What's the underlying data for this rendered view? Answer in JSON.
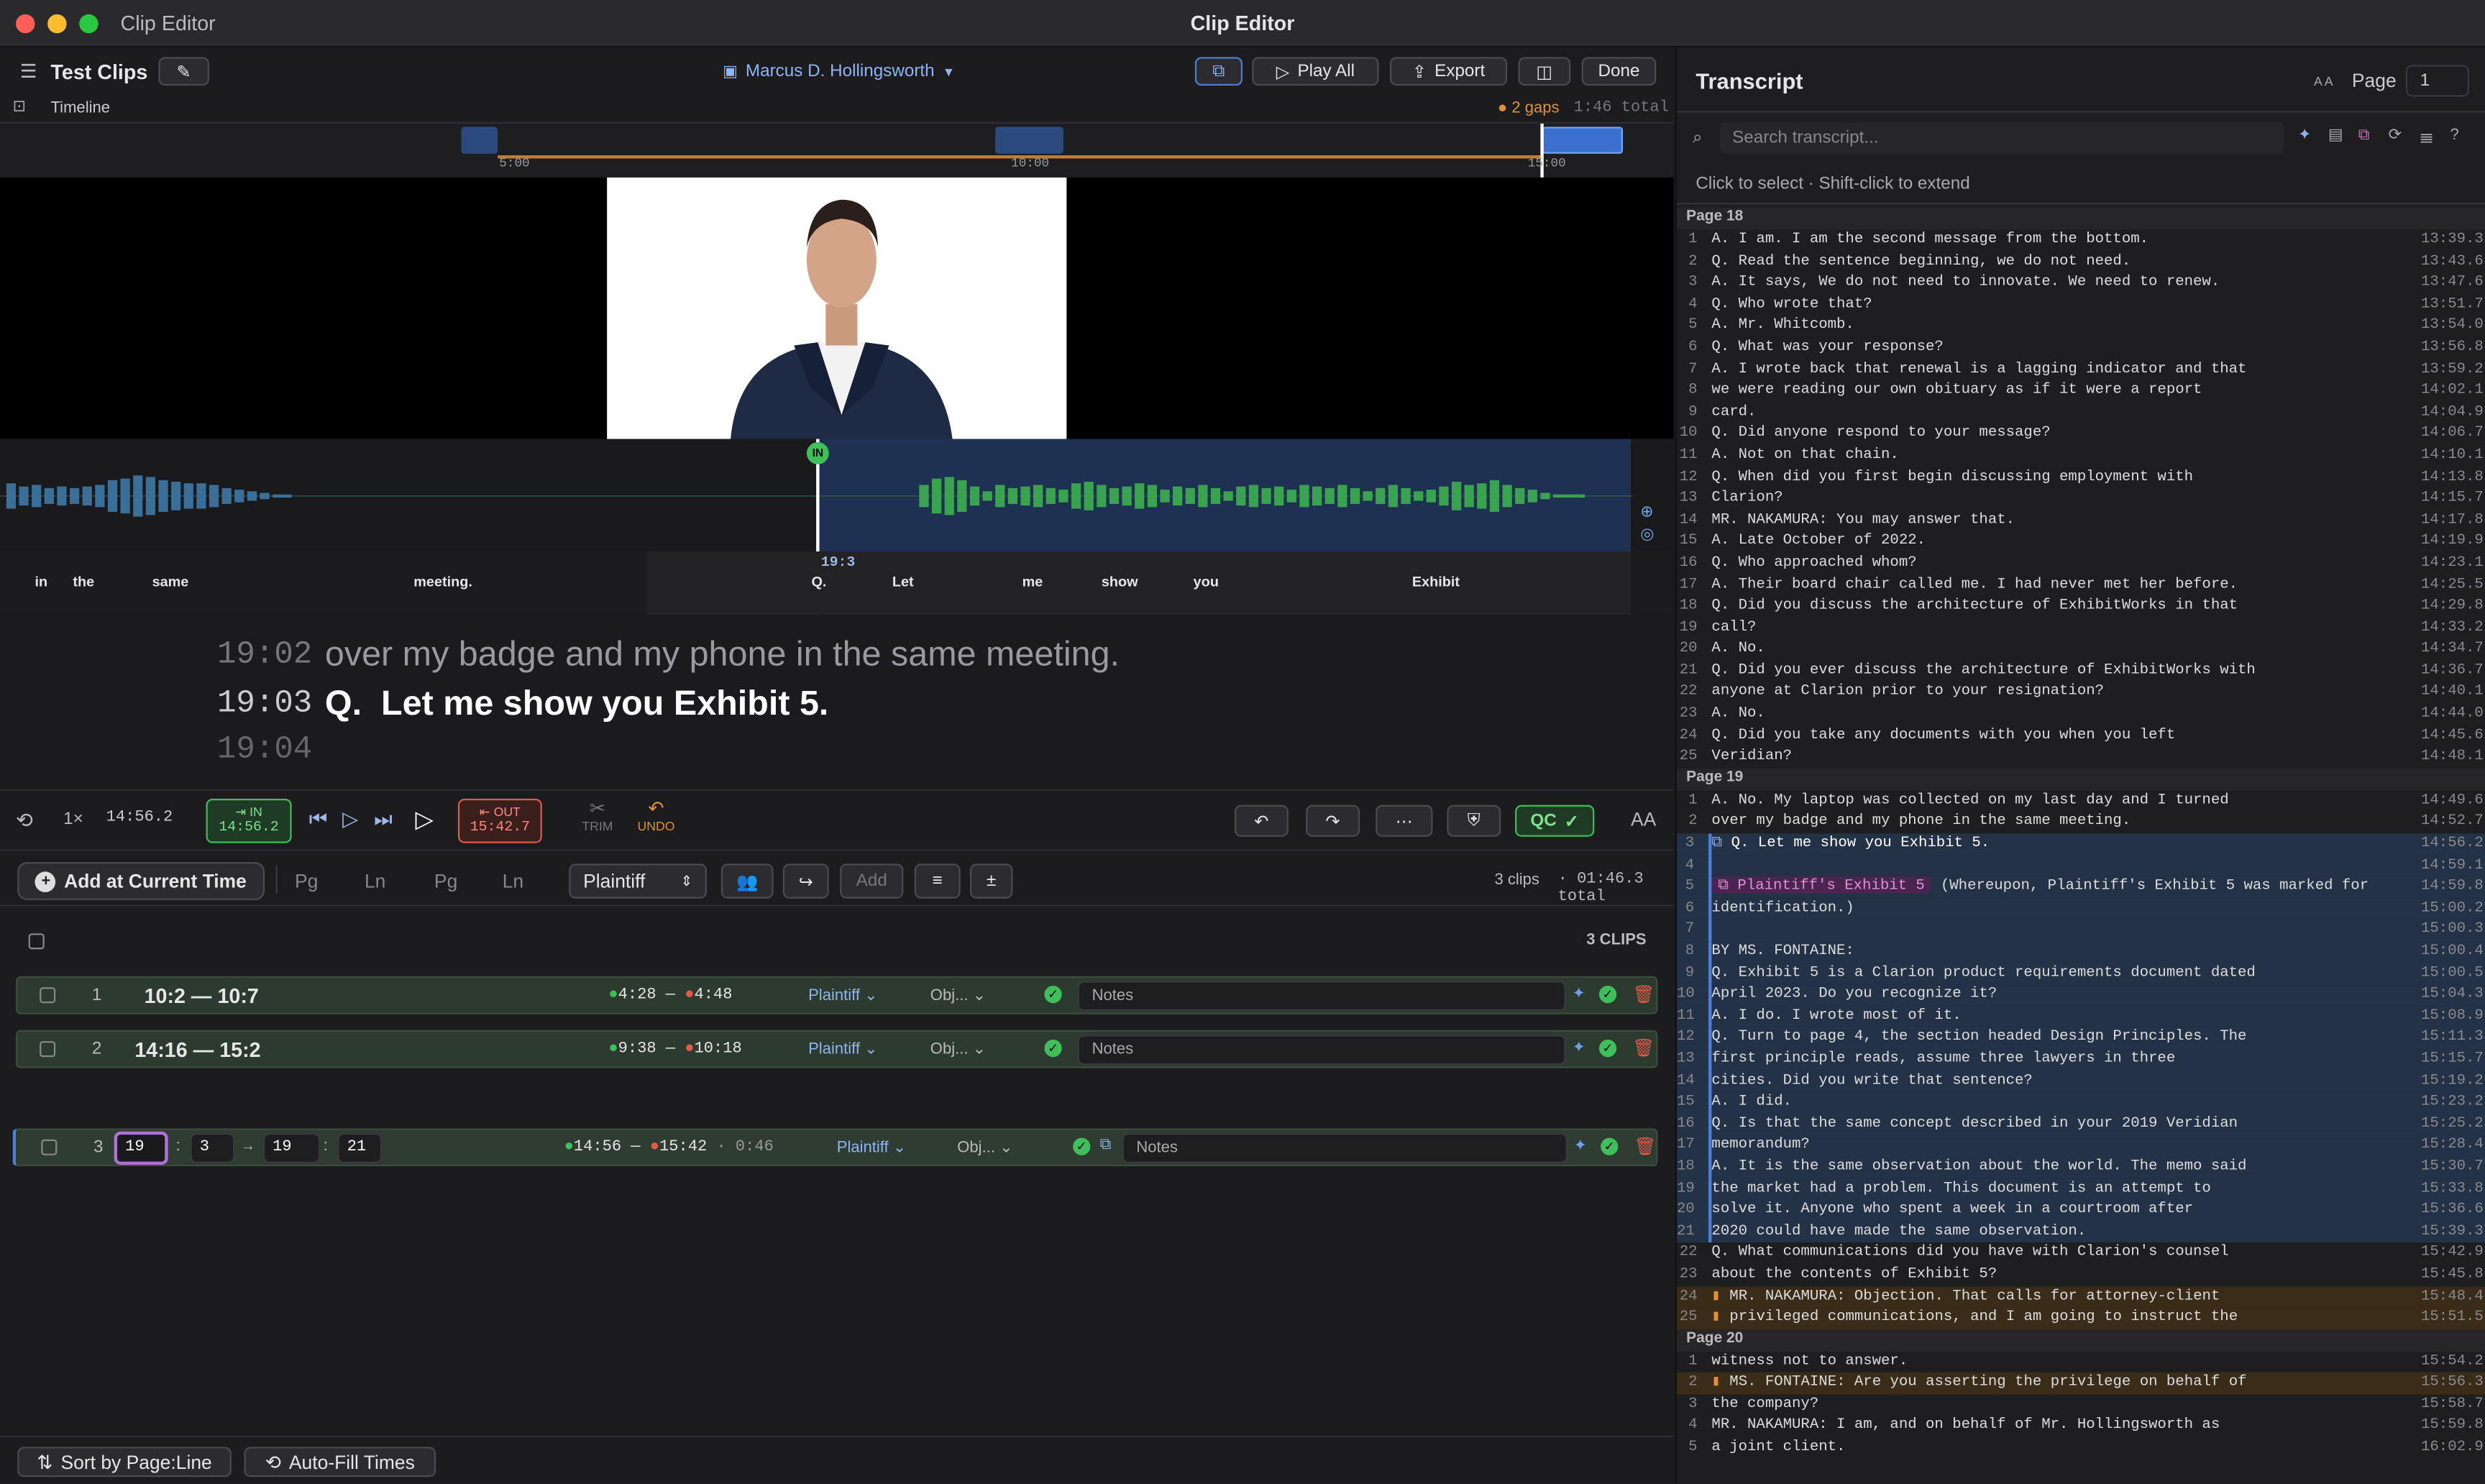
{
  "window": {
    "title": "Clip Editor",
    "app_name": "Clip Editor"
  },
  "toolbar": {
    "project": "Test Clips",
    "witness": "Marcus D. Hollingsworth",
    "play_all": "Play All",
    "export": "Export",
    "done": "Done"
  },
  "timeline": {
    "label": "Timeline",
    "gaps": "2 gaps",
    "total": "1:46 total",
    "ticks": [
      "5:00",
      "10:00",
      "15:00"
    ]
  },
  "waveform": {
    "in_marker": "IN",
    "time": "19:3",
    "words": [
      "in",
      "the",
      "same",
      "meeting.",
      "Q.",
      "Let",
      "me",
      "show",
      "you",
      "Exhibit"
    ]
  },
  "caption": {
    "lines": [
      {
        "time": "19:02",
        "text": "over my badge and my phone in the same meeting."
      },
      {
        "time": "19:03",
        "text": "Q.  Let me show you Exhibit 5."
      },
      {
        "time": "19:04",
        "text": ""
      }
    ]
  },
  "transport": {
    "speed": "1×",
    "time": "14:56.2",
    "in_label": "IN",
    "in_time": "14:56.2",
    "out_label": "OUT",
    "out_time": "15:42.7",
    "trim": "TRIM",
    "undo": "UNDO",
    "qc": "QC",
    "text_size": "AA"
  },
  "addrow": {
    "add_button": "Add at Current Time",
    "pg1": "Pg",
    "ln1": "Ln",
    "pg2": "Pg",
    "ln2": "Ln",
    "party": "Plaintiff",
    "add": "Add",
    "clips_count": "3 clips",
    "total": "· 01:46.3 total"
  },
  "clips": {
    "count_label": "3 CLIPS",
    "rows": [
      {
        "num": "1",
        "range": "10:2 — 10:7",
        "in": "4:28",
        "out": "4:48",
        "party": "Plaintiff",
        "obj": "Obj...",
        "notes": "Notes"
      },
      {
        "num": "2",
        "range": "14:16 — 15:2",
        "in": "9:38",
        "out": "10:18",
        "party": "Plaintiff",
        "obj": "Obj...",
        "notes": "Notes"
      },
      {
        "num": "3",
        "edit": [
          "19",
          "3",
          "19",
          "21"
        ],
        "in": "14:56",
        "out": "15:42",
        "duration": "· 0:46",
        "party": "Plaintiff",
        "obj": "Obj...",
        "notes": "Notes"
      }
    ]
  },
  "bottom": {
    "sort": "Sort by Page:Line",
    "autofill": "Auto-Fill Times"
  },
  "transcript": {
    "title": "Transcript",
    "aa": "A A",
    "page_label": "Page",
    "page_value": "1",
    "search_placeholder": "Search transcript...",
    "hint": "Click to select · Shift-click to extend",
    "pages": [
      {
        "header": "Page 18",
        "lines": [
          {
            "n": "1",
            "t": "A. I am. I am the second message from the bottom.",
            "ts": "13:39.3"
          },
          {
            "n": "2",
            "t": "Q. Read the sentence beginning, we do not need.",
            "ts": "13:43.6"
          },
          {
            "n": "3",
            "t": "A. It says, We do not need to innovate. We need to renew.",
            "ts": "13:47.6"
          },
          {
            "n": "4",
            "t": "Q. Who wrote that?",
            "ts": "13:51.7"
          },
          {
            "n": "5",
            "t": "A. Mr. Whitcomb.",
            "ts": "13:54.0"
          },
          {
            "n": "6",
            "t": "Q. What was your response?",
            "ts": "13:56.8"
          },
          {
            "n": "7",
            "t": "A. I wrote back that renewal is a lagging indicator and that",
            "ts": "13:59.2"
          },
          {
            "n": "8",
            "t": "we were reading our own obituary as if it were a report",
            "ts": "14:02.1"
          },
          {
            "n": "9",
            "t": "card.",
            "ts": "14:04.9"
          },
          {
            "n": "10",
            "t": "Q. Did anyone respond to your message?",
            "ts": "14:06.7"
          },
          {
            "n": "11",
            "t": "A. Not on that chain.",
            "ts": "14:10.1"
          },
          {
            "n": "12",
            "t": "Q. When did you first begin discussing employment with",
            "ts": "14:13.8"
          },
          {
            "n": "13",
            "t": "Clarion?",
            "ts": "14:15.7"
          },
          {
            "n": "14",
            "t": "MR. NAKAMURA: You may answer that.",
            "ts": "14:17.8"
          },
          {
            "n": "15",
            "t": "A. Late October of 2022.",
            "ts": "14:19.9"
          },
          {
            "n": "16",
            "t": "Q. Who approached whom?",
            "ts": "14:23.1"
          },
          {
            "n": "17",
            "t": "A. Their board chair called me. I had never met her before.",
            "ts": "14:25.5"
          },
          {
            "n": "18",
            "t": "Q. Did you discuss the architecture of ExhibitWorks in that",
            "ts": "14:29.8"
          },
          {
            "n": "19",
            "t": "call?",
            "ts": "14:33.2"
          },
          {
            "n": "20",
            "t": "A. No.",
            "ts": "14:34.7"
          },
          {
            "n": "21",
            "t": "Q. Did you ever discuss the architecture of ExhibitWorks with",
            "ts": "14:36.7"
          },
          {
            "n": "22",
            "t": "anyone at Clarion prior to your resignation?",
            "ts": "14:40.1"
          },
          {
            "n": "23",
            "t": "A. No.",
            "ts": "14:44.0"
          },
          {
            "n": "24",
            "t": "Q. Did you take any documents with you when you left",
            "ts": "14:45.6"
          },
          {
            "n": "25",
            "t": "Veridian?",
            "ts": "14:48.1"
          }
        ]
      },
      {
        "header": "Page 19",
        "lines": [
          {
            "n": "1",
            "t": "A. No. My laptop was collected on my last day and I turned",
            "ts": "14:49.6"
          },
          {
            "n": "2",
            "t": "over my badge and my phone in the same meeting.",
            "ts": "14:52.7"
          },
          {
            "n": "3",
            "t": "Q. Let me show you Exhibit 5.",
            "ts": "14:56.2",
            "sel": true,
            "cur": true
          },
          {
            "n": "4",
            "t": "",
            "ts": "14:59.1",
            "sel": true
          },
          {
            "n": "5",
            "t": "(Whereupon, Plaintiff's Exhibit 5 was marked for",
            "ts": "14:59.8",
            "sel": true,
            "exhibit": "Plaintiff's Exhibit 5"
          },
          {
            "n": "6",
            "t": "identification.)",
            "ts": "15:00.2",
            "sel": true
          },
          {
            "n": "7",
            "t": "",
            "ts": "15:00.3",
            "sel": true
          },
          {
            "n": "8",
            "t": "BY MS. FONTAINE:",
            "ts": "15:00.4",
            "sel": true
          },
          {
            "n": "9",
            "t": "Q. Exhibit 5 is a Clarion product requirements document dated",
            "ts": "15:00.5",
            "sel": true
          },
          {
            "n": "10",
            "t": "April 2023. Do you recognize it?",
            "ts": "15:04.3",
            "sel": true
          },
          {
            "n": "11",
            "t": "A. I do. I wrote most of it.",
            "ts": "15:08.9",
            "sel": true
          },
          {
            "n": "12",
            "t": "Q. Turn to page 4, the section headed Design Principles. The",
            "ts": "15:11.3",
            "sel": true
          },
          {
            "n": "13",
            "t": "first principle reads, assume three lawyers in three",
            "ts": "15:15.7",
            "sel": true
          },
          {
            "n": "14",
            "t": "cities. Did you write that sentence?",
            "ts": "15:19.2",
            "sel": true
          },
          {
            "n": "15",
            "t": "A. I did.",
            "ts": "15:23.2",
            "sel": true
          },
          {
            "n": "16",
            "t": "Q. Is that the same concept described in your 2019 Veridian",
            "ts": "15:25.2",
            "sel": true
          },
          {
            "n": "17",
            "t": "memorandum?",
            "ts": "15:28.4",
            "sel": true
          },
          {
            "n": "18",
            "t": "A. It is the same observation about the world. The memo said",
            "ts": "15:30.7",
            "sel": true
          },
          {
            "n": "19",
            "t": "the market had a problem. This document is an attempt to",
            "ts": "15:33.8",
            "sel": true
          },
          {
            "n": "20",
            "t": "solve it. Anyone who spent a week in a courtroom after",
            "ts": "15:36.6",
            "sel": true
          },
          {
            "n": "21",
            "t": "2020 could have made the same observation.",
            "ts": "15:39.3",
            "sel": true
          },
          {
            "n": "22",
            "t": "Q. What communications did you have with Clarion's counsel",
            "ts": "15:42.9"
          },
          {
            "n": "23",
            "t": "about the contents of Exhibit 5?",
            "ts": "15:45.8"
          },
          {
            "n": "24",
            "t": "MR. NAKAMURA: Objection. That calls for attorney-client",
            "ts": "15:48.4",
            "obj": true
          },
          {
            "n": "25",
            "t": "privileged communications, and I am going to instruct the",
            "ts": "15:51.5",
            "obj": true
          }
        ]
      },
      {
        "header": "Page 20",
        "lines": [
          {
            "n": "1",
            "t": "witness not to answer.",
            "ts": "15:54.2"
          },
          {
            "n": "2",
            "t": "MS. FONTAINE: Are you asserting the privilege on behalf of",
            "ts": "15:56.3",
            "obj": true
          },
          {
            "n": "3",
            "t": "the company?",
            "ts": "15:58.7"
          },
          {
            "n": "4",
            "t": "MR. NAKAMURA: I am, and on behalf of Mr. Hollingsworth as",
            "ts": "15:59.8"
          },
          {
            "n": "5",
            "t": "a joint client.",
            "ts": "16:02.9"
          }
        ]
      }
    ]
  },
  "colors": {
    "accent": "#4e7fd6",
    "green": "#3fbf5a",
    "red": "#e05b4a",
    "orange": "#e0903a",
    "exhibit": "#d070c8"
  }
}
